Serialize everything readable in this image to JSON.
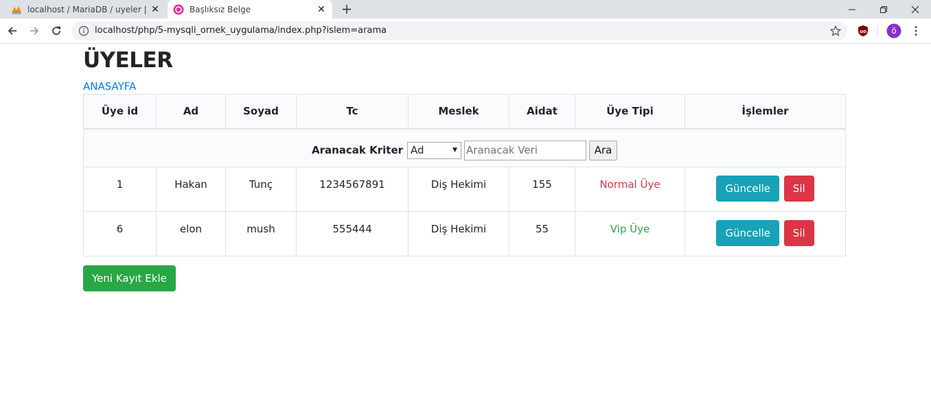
{
  "browser": {
    "tabs": [
      {
        "title": "localhost / MariaDB / uyeler | php",
        "icon": "phpmyadmin-icon",
        "active": false
      },
      {
        "title": "Başlıksız Belge",
        "icon": "page-icon",
        "active": true
      }
    ],
    "url": "localhost/php/5-mysqli_ornek_uygulama/index.php?islem=arama",
    "profile_initial": "ö",
    "extension_label": "uo"
  },
  "page": {
    "title": "ÜYELER",
    "home_link": "ANASAYFA",
    "search": {
      "label": "Aranacak Kriter",
      "selected": "Ad",
      "placeholder": "Aranacak Veri",
      "button": "Ara"
    },
    "columns": [
      "Üye id",
      "Ad",
      "Soyad",
      "Tc",
      "Meslek",
      "Aidat",
      "Üye Tipi",
      "İşlemler"
    ],
    "rows": [
      {
        "id": "1",
        "ad": "Hakan",
        "soyad": "Tunç",
        "tc": "1234567891",
        "meslek": "Diş Hekimi",
        "aidat": "155",
        "tip": "Normal Üye",
        "tip_color": "#dc3545",
        "update": "Güncelle",
        "delete": "Sil"
      },
      {
        "id": "6",
        "ad": "elon",
        "soyad": "mush",
        "tc": "555444",
        "meslek": "Diş Hekimi",
        "aidat": "55",
        "tip": "Vip Üye",
        "tip_color": "#28a745",
        "update": "Güncelle",
        "delete": "Sil"
      }
    ],
    "add_button": "Yeni Kayıt Ekle"
  },
  "colors": {
    "primary": "#007bff",
    "info": "#17a2b8",
    "danger": "#dc3545",
    "success": "#28a745"
  }
}
